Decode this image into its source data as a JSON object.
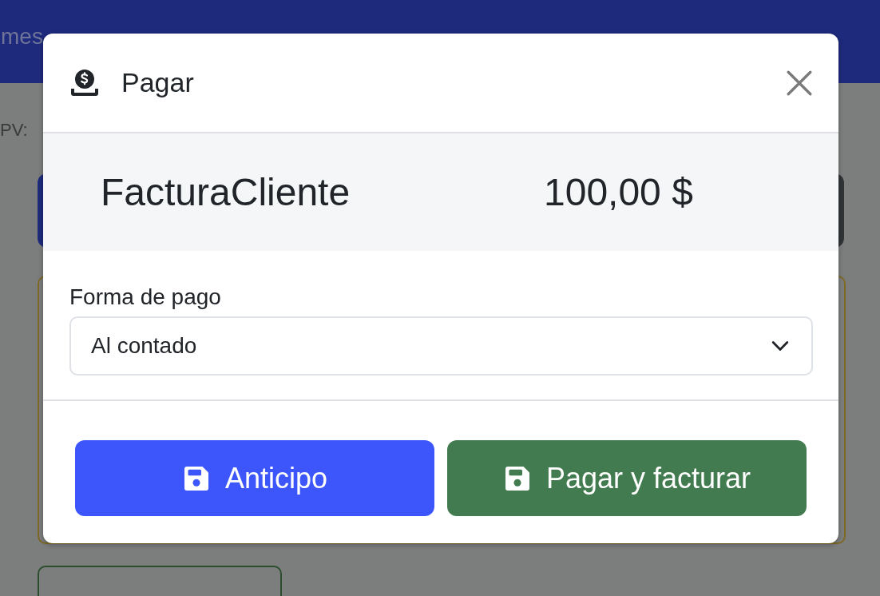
{
  "background": {
    "nav_text": "mes",
    "pv_label": "PV:"
  },
  "dialog": {
    "title": "Pagar",
    "summary": {
      "document": "FacturaCliente",
      "amount": "100,00 $"
    },
    "field": {
      "label": "Forma de pago",
      "value": "Al contado"
    },
    "buttons": [
      {
        "label": "Anticipo",
        "kind": "primary"
      },
      {
        "label": "Pagar y facturar",
        "kind": "success"
      }
    ]
  }
}
